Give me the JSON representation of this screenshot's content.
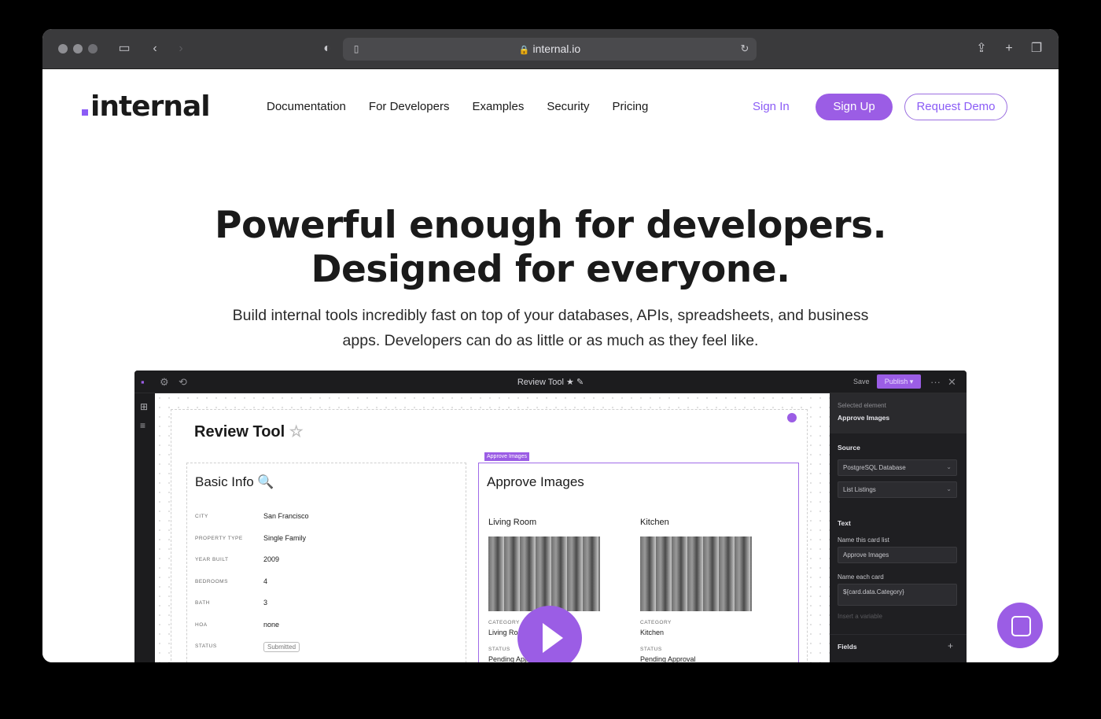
{
  "browser": {
    "url": "internal.io"
  },
  "header": {
    "logo": "internal",
    "nav": [
      "Documentation",
      "For Developers",
      "Examples",
      "Security",
      "Pricing"
    ],
    "sign_in": "Sign In",
    "sign_up": "Sign Up",
    "request_demo": "Request Demo"
  },
  "hero": {
    "line1": "Powerful enough for developers.",
    "line2": "Designed for everyone.",
    "subtitle": "Build internal tools incredibly fast on top of your databases, APIs, spreadsheets, and business apps. Developers can do as little or as much as they feel like."
  },
  "app": {
    "title": "Review Tool",
    "save": "Save",
    "publish": "Publish",
    "page_title": "Review Tool",
    "basic_info": {
      "title": "Basic Info 🔍",
      "rows": [
        {
          "key": "CITY",
          "value": "San Francisco"
        },
        {
          "key": "PROPERTY TYPE",
          "value": "Single Family"
        },
        {
          "key": "YEAR BUILT",
          "value": "2009"
        },
        {
          "key": "BEDROOMS",
          "value": "4"
        },
        {
          "key": "BATH",
          "value": "3"
        },
        {
          "key": "HOA",
          "value": "none"
        },
        {
          "key": "STATUS",
          "value": "Submitted"
        }
      ]
    },
    "approve": {
      "tag": "Approve Images",
      "title": "Approve Images",
      "cards": [
        {
          "title": "Living Room",
          "category_label": "CATEGORY",
          "category": "Living Room",
          "status_label": "STATUS",
          "status": "Pending Approval"
        },
        {
          "title": "Kitchen",
          "category_label": "CATEGORY",
          "category": "Kitchen",
          "status_label": "STATUS",
          "status": "Pending Approval"
        }
      ]
    },
    "sidebar": {
      "selected_label": "Selected element",
      "selected_value": "Approve Images",
      "source_label": "Source",
      "source_db": "PostgreSQL Database",
      "source_query": "List Listings",
      "text_label": "Text",
      "name_list_label": "Name this card list",
      "name_list_value": "Approve Images",
      "name_card_label": "Name each card",
      "name_card_value": "${card.data.Category}",
      "insert_variable": "Insert a variable",
      "fields_label": "Fields"
    }
  }
}
